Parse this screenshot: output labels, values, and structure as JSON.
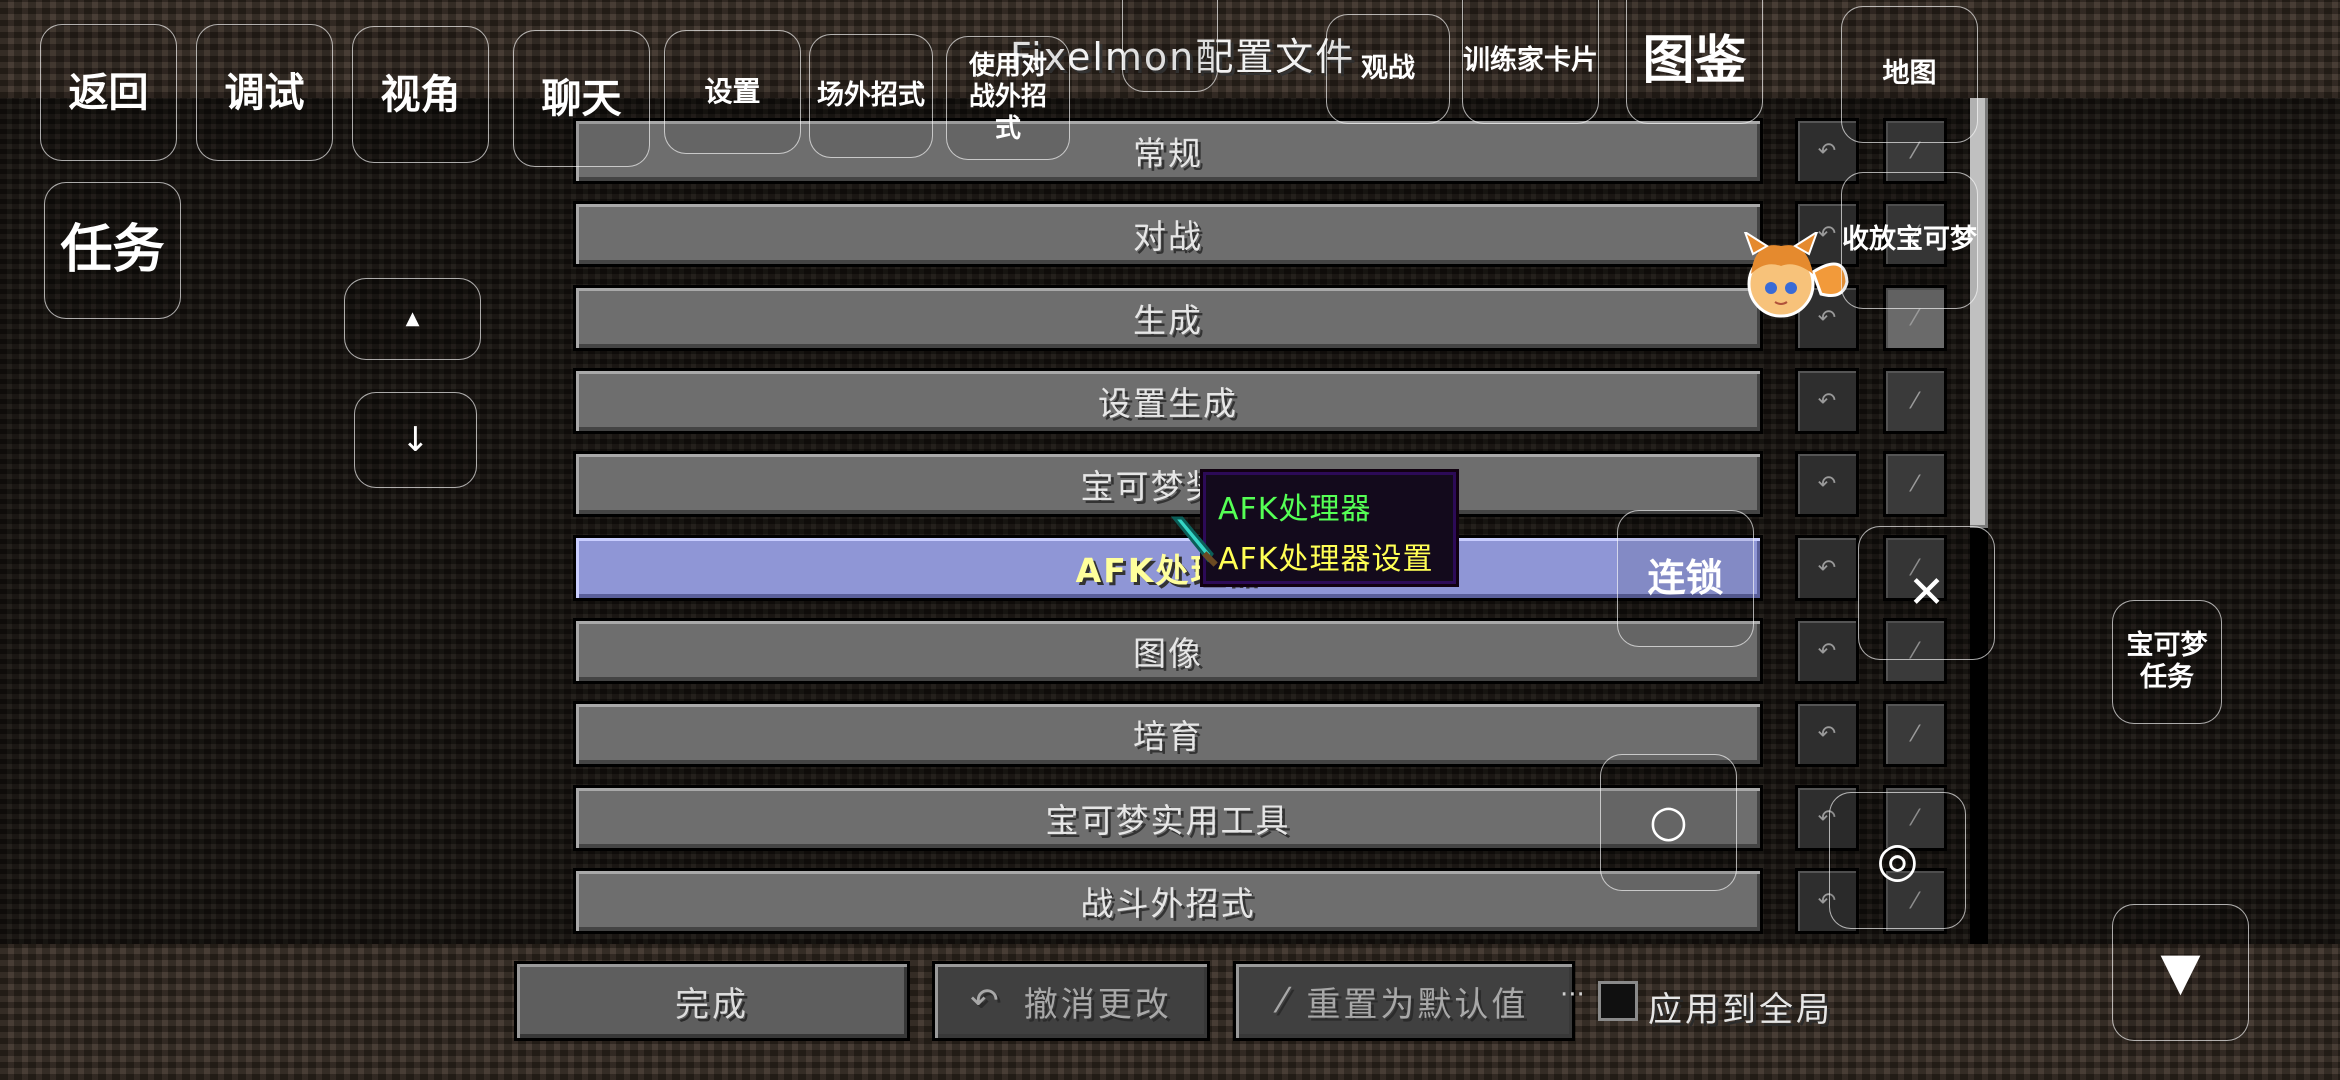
{
  "title": "Fixelmon配置文件",
  "top_buttons": {
    "back": "返回",
    "debug": "调试",
    "view": "视角",
    "chat": "聊天",
    "settings": "设置",
    "out_battle_move": "场外招式",
    "use_battle_move": "使用对战外招式",
    "spectate": "观战",
    "trainer_card": "训练家卡片",
    "pokedex": "图鉴",
    "map": "地图"
  },
  "left_controls": {
    "quest": "任务",
    "up_arrow": "▲",
    "down_arrow": "↓"
  },
  "right_controls": {
    "toggle_pokemon": "收放宝可梦",
    "chain": "连锁",
    "pokemon_quest": "宝可梦任务",
    "close": "✕",
    "circle_a": "○",
    "circle_b": "◎",
    "down": "▼"
  },
  "config_sections": [
    {
      "label": "常规"
    },
    {
      "label": "对战"
    },
    {
      "label": "生成"
    },
    {
      "label": "设置生成"
    },
    {
      "label": "宝可梦奖励"
    },
    {
      "label": "AFK处理器",
      "selected": true
    },
    {
      "label": "图像"
    },
    {
      "label": "培育"
    },
    {
      "label": "宝可梦实用工具"
    },
    {
      "label": "战斗外招式"
    }
  ],
  "row_undo_icon": "↶",
  "row_reset_icon": "⁄",
  "tooltip": {
    "title": "AFK处理器",
    "subtitle": "AFK处理器设置"
  },
  "bottom": {
    "done": "完成",
    "undo_changes": "撤消更改",
    "reset_default": "重置为默认值",
    "apply_global": "应用到全局",
    "ellipsis": "···"
  },
  "colors": {
    "tooltip_title": "#55ff55",
    "tooltip_subtitle": "#ffff55",
    "selected_row": "#8f96d6"
  }
}
